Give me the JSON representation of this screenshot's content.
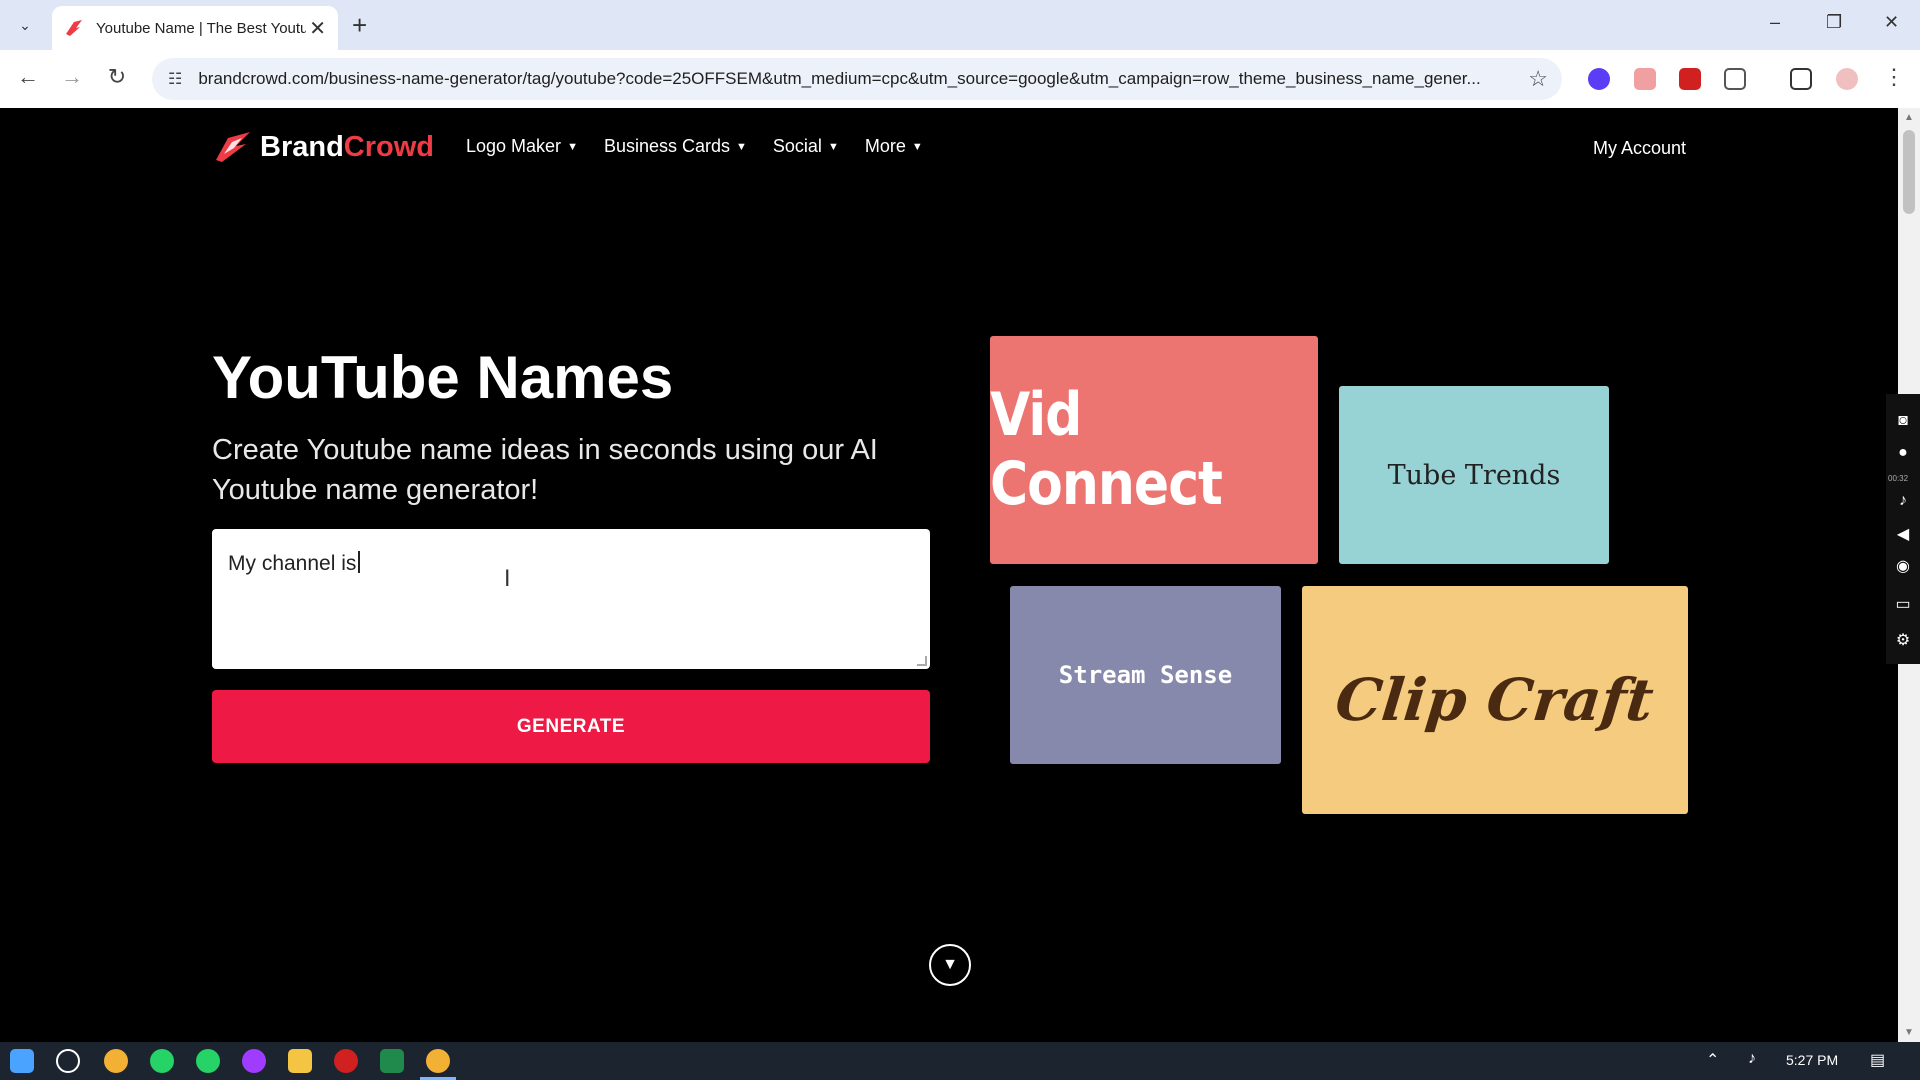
{
  "browser": {
    "tab_title": "Youtube Name | The Best Youtu",
    "new_tab_symbol": "+",
    "tab_close_symbol": "✕",
    "url": "brandcrowd.com/business-name-generator/tag/youtube?code=25OFFSEM&utm_medium=cpc&utm_source=google&utm_campaign=row_theme_business_name_gener...",
    "minimize_symbol": "–",
    "restore_symbol": "❐",
    "close_symbol": "✕"
  },
  "site": {
    "brand_part1": "Brand",
    "brand_part2": "Crowd",
    "nav": [
      {
        "label": "Logo Maker"
      },
      {
        "label": "Business Cards"
      },
      {
        "label": "Social"
      },
      {
        "label": "More"
      }
    ],
    "account_label": "My Account"
  },
  "hero": {
    "title": "YouTube Names",
    "subtitle": "Create Youtube name ideas in seconds using our AI Youtube name generator!",
    "prompt_value": "My channel is",
    "generate_label": "GENERATE"
  },
  "examples": [
    {
      "name": "Vid Connect",
      "color": "#ec7471"
    },
    {
      "name": "Tube Trends",
      "color": "#97d3d5"
    },
    {
      "name": "Stream Sense",
      "color": "#8689ac"
    },
    {
      "name": "Clip Craft",
      "color": "#f4cb7f"
    }
  ],
  "recorder": {
    "timer": "00:32"
  },
  "taskbar": {
    "time": "5:27 PM"
  },
  "colors": {
    "brand_red": "#ee3b45",
    "generate_bg": "#ee1944",
    "page_bg": "#000000"
  }
}
